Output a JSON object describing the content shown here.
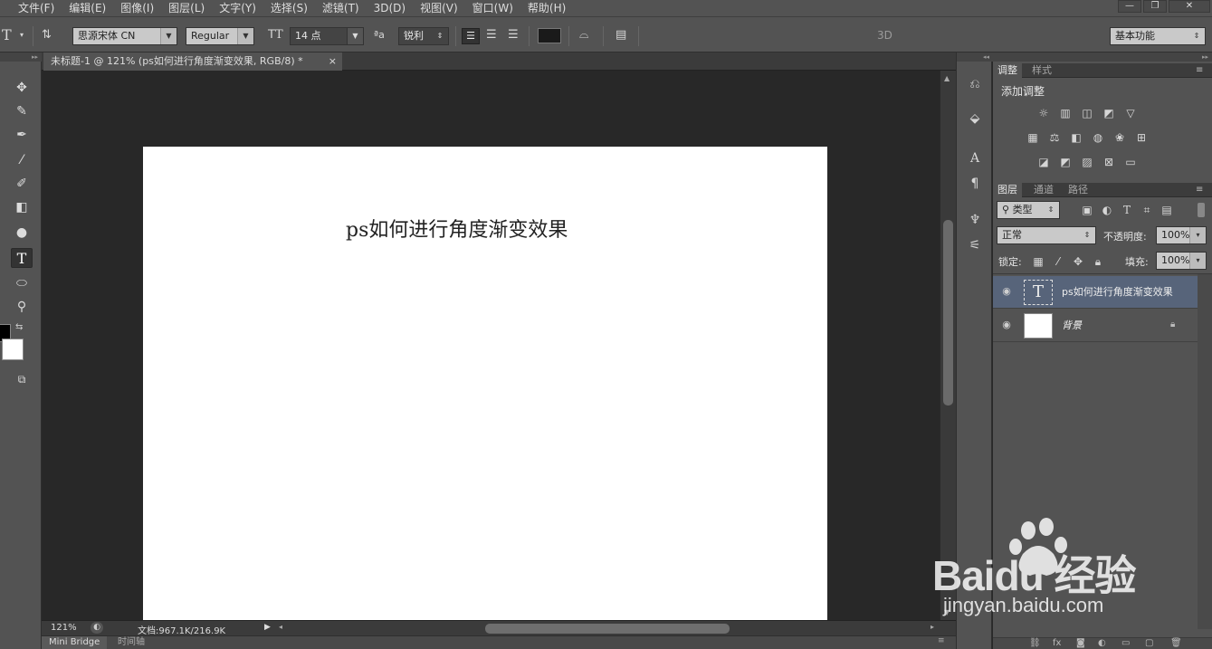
{
  "menubar": {
    "items": [
      "文件(F)",
      "编辑(E)",
      "图像(I)",
      "图层(L)",
      "文字(Y)",
      "选择(S)",
      "滤镜(T)",
      "3D(D)",
      "视图(V)",
      "窗口(W)",
      "帮助(H)"
    ],
    "window_buttons": [
      "—",
      "❐",
      "✕"
    ]
  },
  "options_bar": {
    "tool_icon": "T",
    "font_family": "思源宋体 CN",
    "font_style": "Regular",
    "font_size": "14 点",
    "antialias_icon": "ªa",
    "antialias": "锐利",
    "text_color": "#1a1a1a",
    "label_3d": "3D",
    "workspace": "基本功能"
  },
  "document": {
    "tab_title": "未标题-1 @ 121% (ps如何进行角度渐变效果, RGB/8) *",
    "tab_close": "×",
    "canvas_text": "ps如何进行角度渐变效果"
  },
  "status": {
    "zoom": "121%",
    "doc_info": "文档:967.1K/216.9K"
  },
  "bottom_tabs": [
    "Mini Bridge",
    "时间轴"
  ],
  "adjustments_panel": {
    "tabs": [
      "调整",
      "样式"
    ],
    "title": "添加调整"
  },
  "layers_panel": {
    "tabs": [
      "图层",
      "通道",
      "路径"
    ],
    "filter_kind": "类型",
    "blend_mode": "正常",
    "opacity_label": "不透明度:",
    "opacity_value": "100%",
    "lock_label": "锁定:",
    "fill_label": "填充:",
    "fill_value": "100%",
    "layers": [
      {
        "name": "ps如何进行角度渐变效果",
        "type": "text",
        "selected": true
      },
      {
        "name": "背景",
        "type": "background",
        "locked": true
      }
    ]
  },
  "watermark": {
    "brand": "Baidu 经验",
    "url": "jingyan.baidu.com"
  },
  "colors": {
    "panel_bg": "#535353",
    "canvas_bg": "#282828",
    "selected_layer": "#57647a",
    "foreground": "#000000",
    "background": "#ffffff"
  }
}
